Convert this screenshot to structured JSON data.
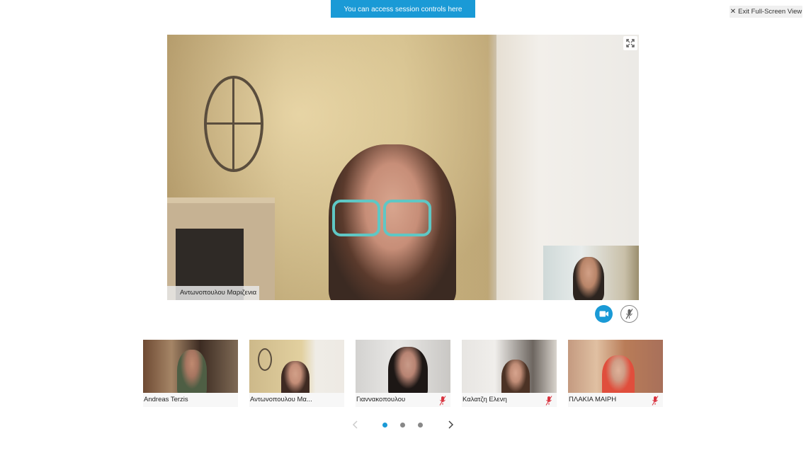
{
  "banner": {
    "text": "You can access session controls here"
  },
  "exit_button": {
    "label": "Exit Full-Screen View"
  },
  "main_video": {
    "participant_name": "Αντωνοπουλου Μαριζενια",
    "expand_icon": "expand-icon"
  },
  "controls": {
    "camera_icon": "video-camera-icon",
    "mic_icon": "microphone-muted-icon",
    "camera_color": "#1a9ad6"
  },
  "participants": [
    {
      "name": "Andreas Terzis",
      "muted": false
    },
    {
      "name": "Αντωνοπουλου Μα...",
      "muted": false
    },
    {
      "name": "Γιαννακοπουλου",
      "muted": true
    },
    {
      "name": "Καλατζη Ελενη",
      "muted": true
    },
    {
      "name": "ΠΛΑΚΙΑ ΜΑΙΡΗ",
      "muted": true
    }
  ],
  "pagination": {
    "pages": 3,
    "current": 1
  },
  "colors": {
    "accent": "#1a9ad6",
    "muted_red": "#d9333f"
  }
}
